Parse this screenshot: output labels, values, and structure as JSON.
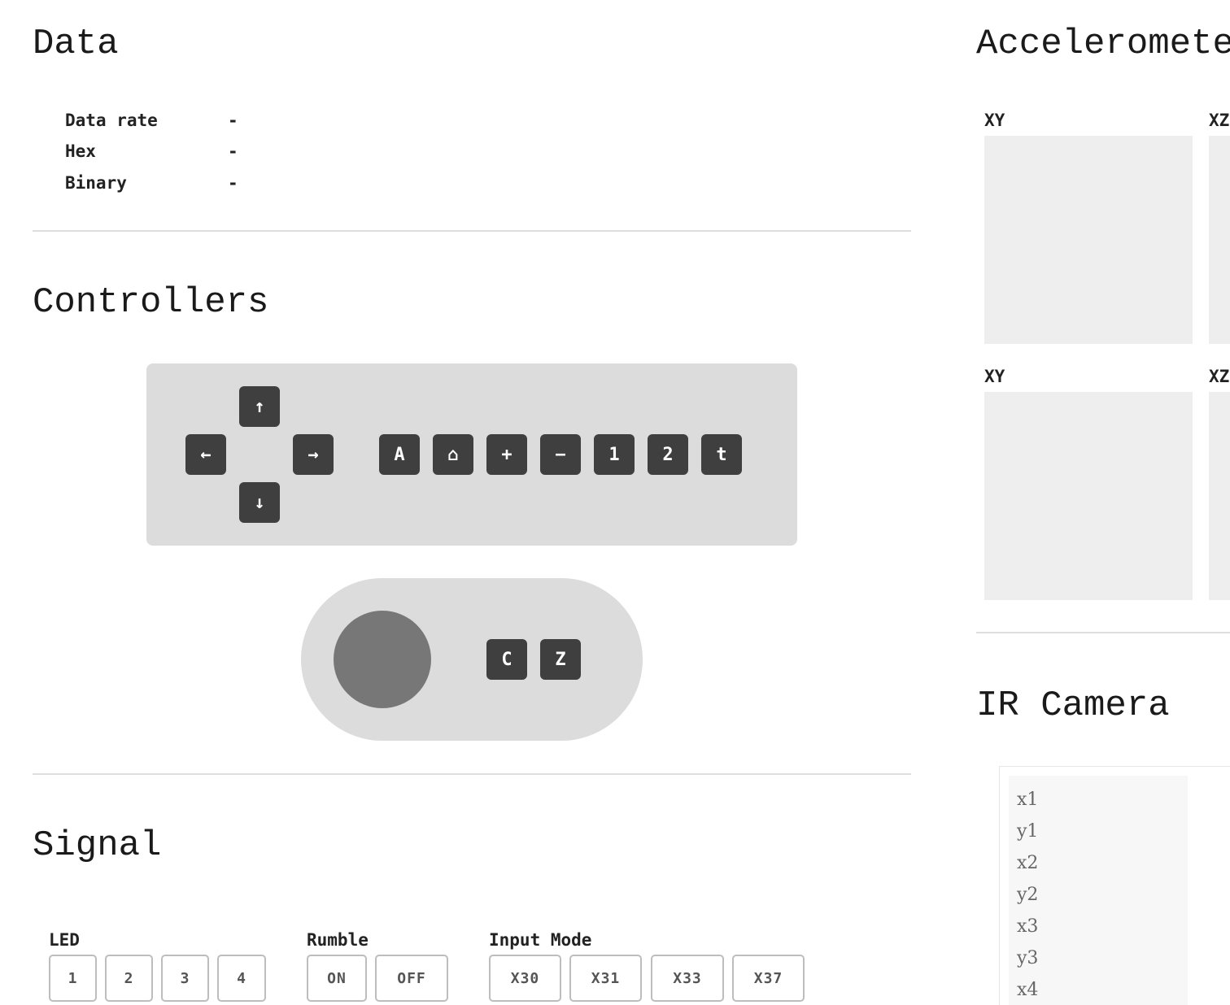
{
  "data_section": {
    "title": "Data",
    "rows": [
      {
        "label": "Data rate",
        "value": "-"
      },
      {
        "label": "Hex",
        "value": "-"
      },
      {
        "label": "Binary",
        "value": "-"
      }
    ]
  },
  "controllers": {
    "title": "Controllers",
    "dpad": {
      "up": "↑",
      "left": "←",
      "right": "→",
      "down": "↓"
    },
    "buttons": [
      "A",
      "⌂",
      "+",
      "−",
      "1",
      "2",
      "t"
    ],
    "nunchuk_buttons": [
      "C",
      "Z"
    ]
  },
  "signal": {
    "title": "Signal",
    "led": {
      "label": "LED",
      "buttons": [
        "1",
        "2",
        "3",
        "4"
      ]
    },
    "rumble": {
      "label": "Rumble",
      "buttons": [
        "ON",
        "OFF"
      ]
    },
    "input_mode": {
      "label": "Input Mode",
      "buttons": [
        "X30",
        "X31",
        "X33",
        "X37"
      ]
    }
  },
  "accelerometer": {
    "title": "Acceleromete",
    "plots": [
      "XY",
      "XZ",
      "XY",
      "XZ"
    ]
  },
  "ir_camera": {
    "title": "IR Camera",
    "fields": [
      "x1",
      "y1",
      "x2",
      "y2",
      "x3",
      "y3",
      "x4"
    ]
  }
}
